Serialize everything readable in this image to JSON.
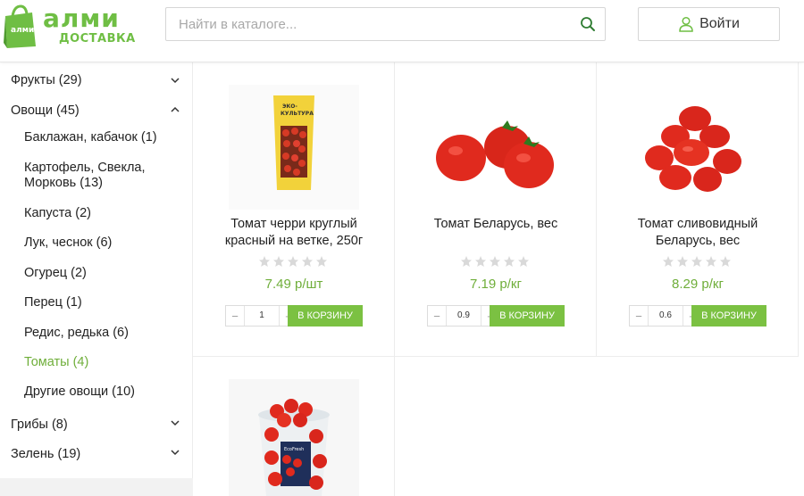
{
  "brand": {
    "name": "алми",
    "subtitle": "ДОСТАВКА",
    "bag_text": "алми",
    "color": "#6fbe44"
  },
  "search": {
    "placeholder": "Найти в каталоге...",
    "value": ""
  },
  "login": {
    "label": "Войти"
  },
  "sidebar": {
    "categories": [
      {
        "label": "Фрукты (29)",
        "expanded": false
      },
      {
        "label": "Овощи (45)",
        "expanded": true,
        "children": [
          {
            "label": "Баклажан, кабачок (1)"
          },
          {
            "label": "Картофель, Свекла,",
            "label2": "Морковь (13)"
          },
          {
            "label": "Капуста (2)"
          },
          {
            "label": "Лук, чеснок (6)"
          },
          {
            "label": "Огурец (2)"
          },
          {
            "label": "Перец (1)"
          },
          {
            "label": "Редис, редька (6)"
          },
          {
            "label": "Томаты (4)",
            "active": true
          },
          {
            "label": "Другие овощи (10)"
          }
        ]
      },
      {
        "label": "Грибы (8)",
        "expanded": false
      },
      {
        "label": "Зелень (19)",
        "expanded": false
      }
    ]
  },
  "products": [
    {
      "title_line1": "Томат черри круглый",
      "title_line2": "красный на ветке, 250г",
      "price": "7.49 р/шт",
      "qty": "1",
      "rating": 0,
      "pack_text1": "ЭКО-",
      "pack_text2": "КУЛЬТУРА"
    },
    {
      "title_line1": "Томат Беларусь, вес",
      "title_line2": "",
      "price": "7.19 р/кг",
      "qty": "0.9",
      "rating": 0
    },
    {
      "title_line1": "Томат сливовидный",
      "title_line2": "Беларусь, вес",
      "price": "8.29 р/кг",
      "qty": "0.6",
      "rating": 0
    },
    {
      "title_line1": "",
      "title_line2": "",
      "price": "",
      "qty": "",
      "rating": 0,
      "pack_text": "EcoFresh"
    }
  ],
  "ui": {
    "add_to_cart": "В КОРЗИНУ",
    "minus": "−",
    "plus": "+"
  },
  "colors": {
    "accent": "#7bc142",
    "price": "#6fae3a",
    "active_link": "#6fae3a",
    "tomato": "#e02a1e"
  }
}
